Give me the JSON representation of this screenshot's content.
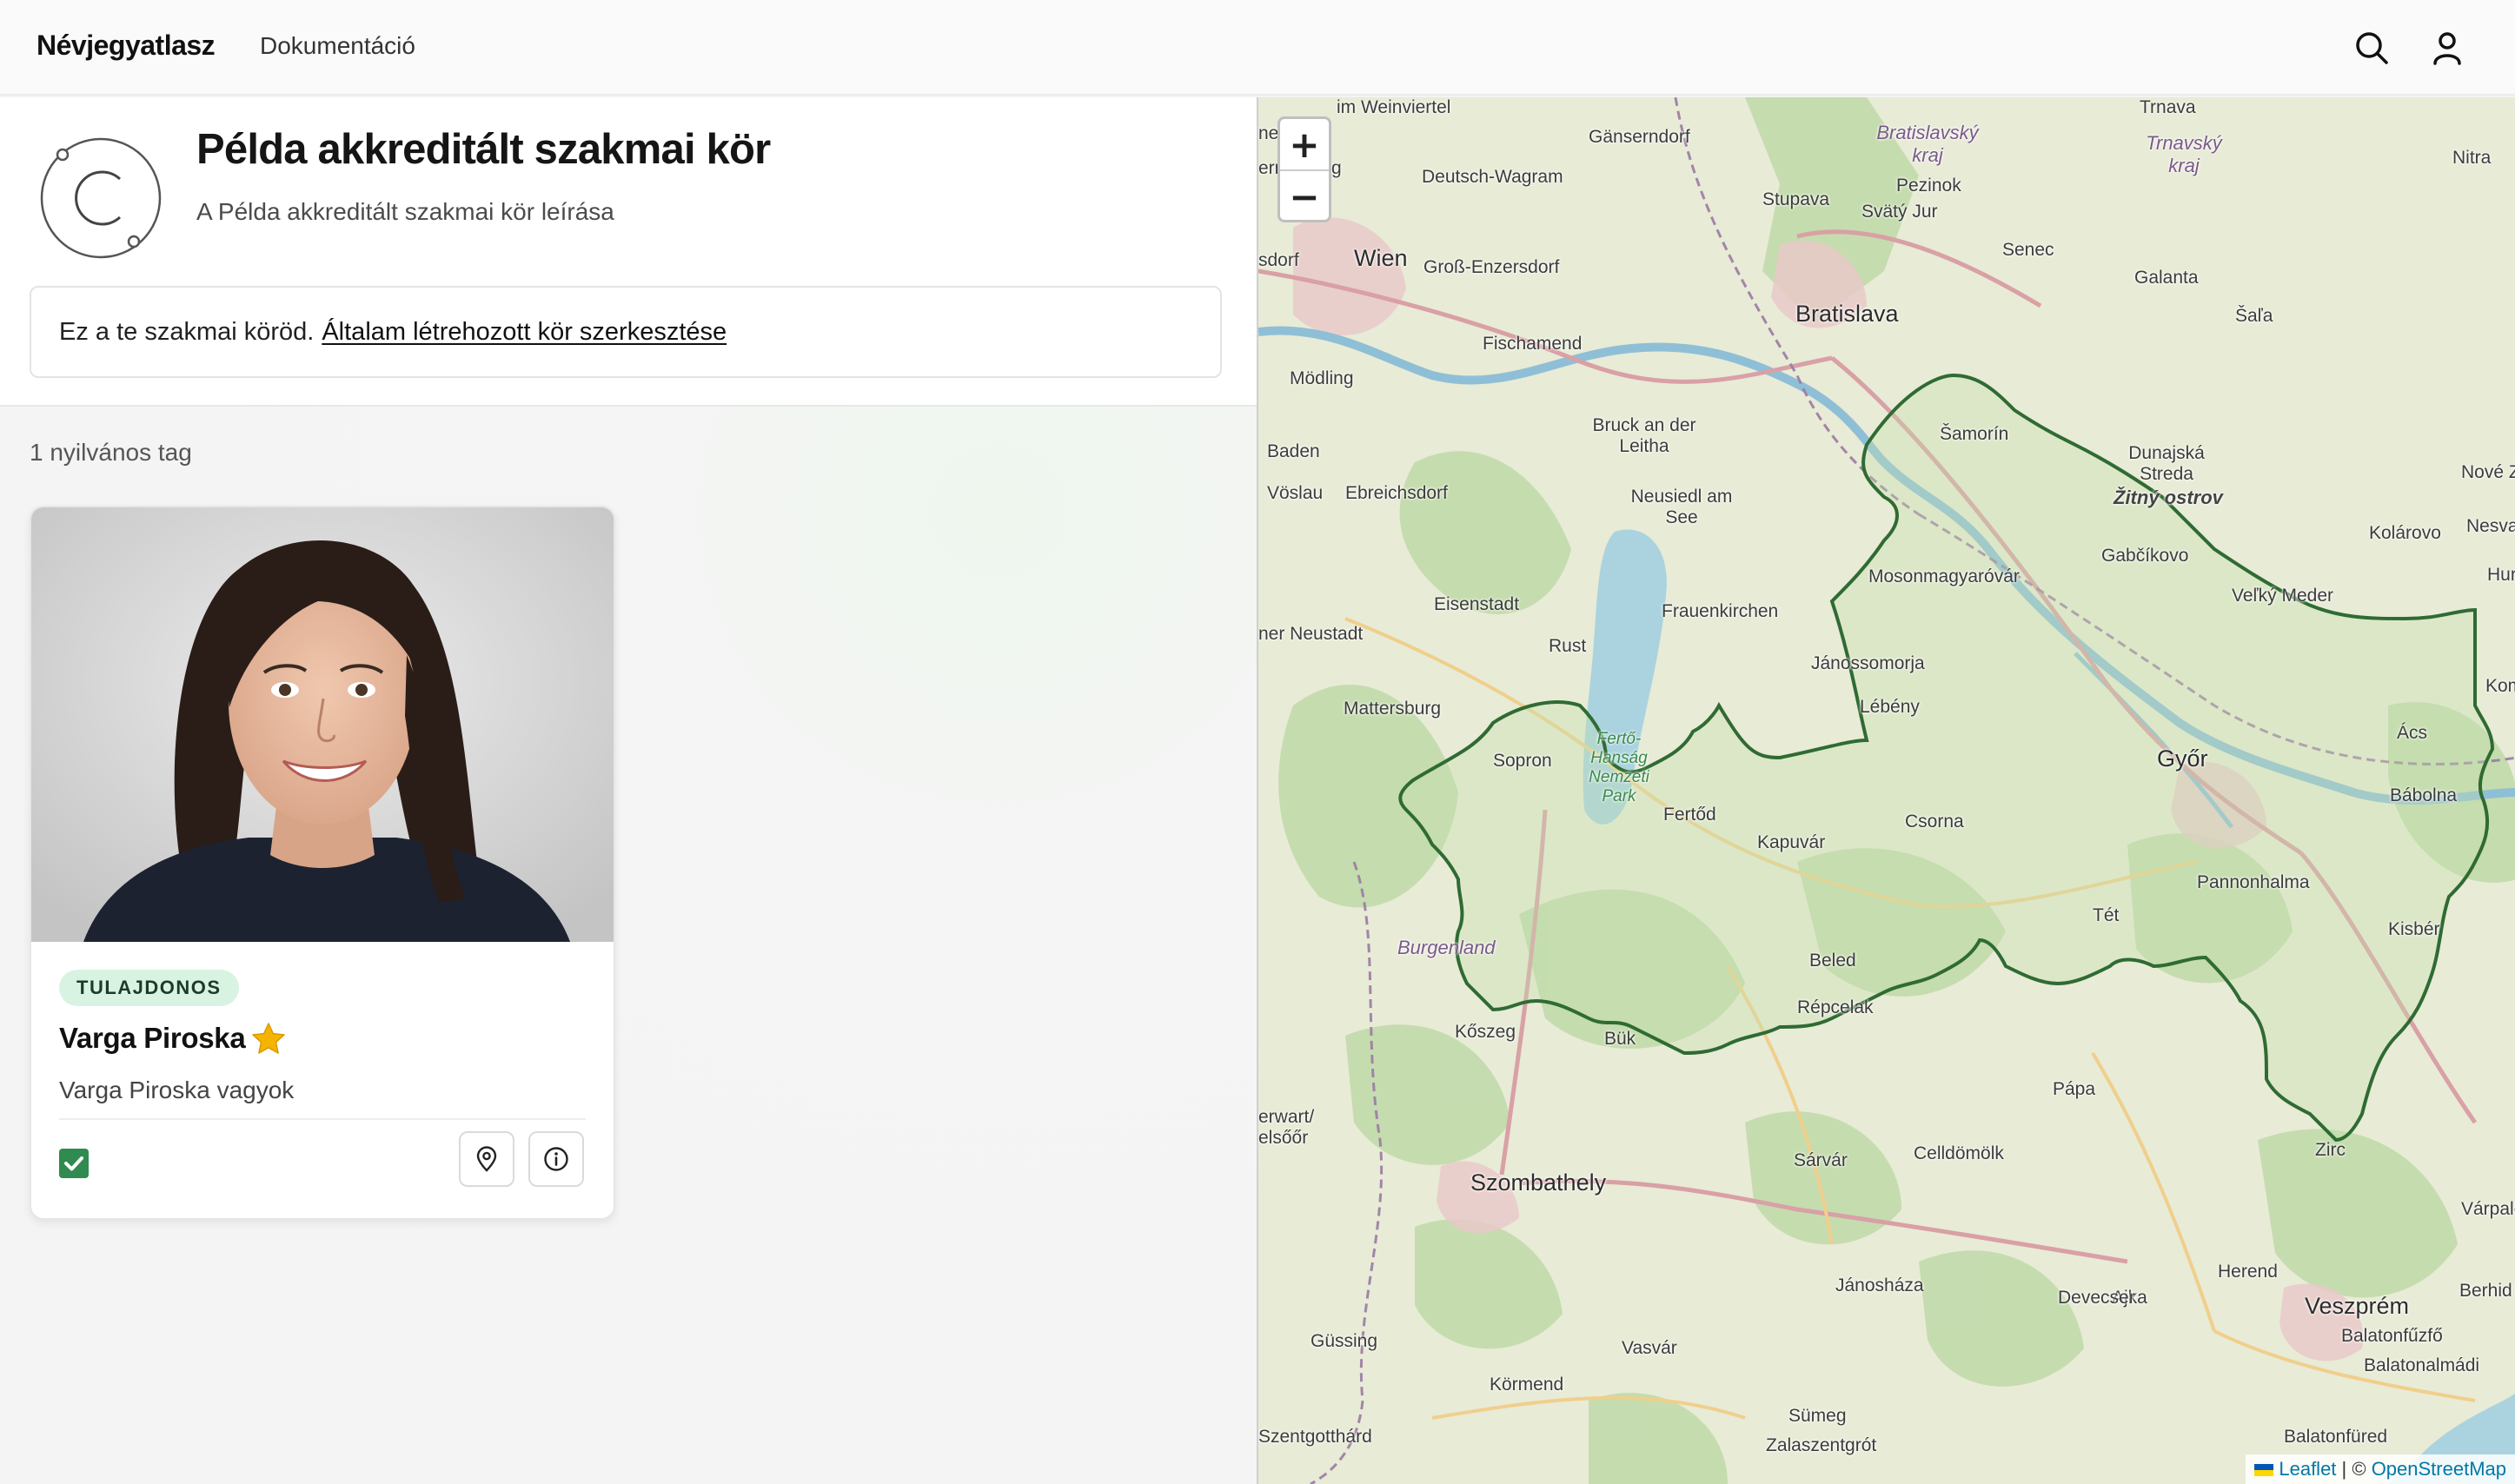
{
  "header": {
    "brand": "Névjegyatlasz",
    "nav_documentation": "Dokumentáció",
    "icons": [
      "search-icon",
      "user-icon"
    ]
  },
  "circle": {
    "title": "Példa akkreditált szakmai kör",
    "description": "A Példa akkreditált szakmai kör leírása",
    "notice_text": "Ez a te szakmai köröd.",
    "notice_link": "Általam létrehozott kör szerkesztése",
    "member_count": "1 nyilvános tag"
  },
  "member": {
    "badge": "TULAJDONOS",
    "name": "Varga Piroska",
    "bio": "Varga Piroska vagyok",
    "checked": true,
    "actions": [
      "location-pin-icon",
      "info-icon"
    ]
  },
  "map": {
    "zoom_in": "+",
    "zoom_out": "−",
    "attribution_leaflet": "Leaflet",
    "attribution_sep": " | © ",
    "attribution_osm": "OpenStreetMap",
    "labels": {
      "wien": "Wien",
      "bratislava": "Bratislava",
      "gyor": "Győr",
      "szombathely": "Szombathely",
      "veszprem": "Veszprém",
      "sopron": "Sopron",
      "mosonmagyarovar": "Mosonmagyaróvár",
      "papa": "Pápa",
      "kapuvar": "Kapuvár",
      "csorna": "Csorna",
      "zitny": "Žitný ostrov",
      "burgenland": "Burgenland",
      "trnava": "Trnava",
      "nitra": "Nitra",
      "samorin": "Šamorín",
      "eisenstadt": "Eisenstadt",
      "neusiedl": "Neusiedl am See",
      "bruck": "Bruck an der Leitha",
      "koszeg": "Kőszeg",
      "tet": "Tét",
      "pannonhalma": "Pannonhalma",
      "kisber": "Kisbér",
      "babolna": "Bábolna",
      "acs": "Ács",
      "zirc": "Zirc",
      "sarvar": "Sárvár",
      "celldomolk": "Celldömölk",
      "fertod": "Fertőd",
      "beled": "Beled",
      "repcelak": "Répcelak",
      "buk": "Bük",
      "mattersburg": "Mattersburg",
      "janoshaza": "Jánosháza",
      "sumeg": "Sümeg",
      "herend": "Herend",
      "ajka": "Ajka",
      "devecser": "Devecser",
      "kormend": "Körmend",
      "vasvar": "Vasvár",
      "gabcikovo": "Gabčíkovo",
      "velky_meder": "Veľký Meder",
      "dunajska": "Dunajská Streda",
      "senec": "Senec",
      "stupava": "Stupava",
      "lebeny": "Lébény",
      "janossomorja": "Jánossomorja",
      "frauenkirchen": "Frauenkirchen",
      "rust": "Rust",
      "fischamend": "Fischamend",
      "modling": "Mödling",
      "baden": "Baden",
      "ebreichsdorf": "Ebreichsdorf",
      "gross_enzersdorf": "Groß-Enzersdorf",
      "deutsch_wagram": "Deutsch-Wagram",
      "gansendorf": "Gänserndorf",
      "svaty_jur": "Svätý Jur",
      "pezinok": "Pezinok",
      "galanta": "Galanta",
      "sala": "Šaľa",
      "kolarovo": "Kolárovo",
      "komarno": "Komárn",
      "gussing": "Güssing",
      "szentgotthard": "Szentgotthárd",
      "zalaszentgrot": "Zalaszentgrót",
      "balatonfured": "Balatonfüred",
      "balatonfuzfo": "Balatonfűzfő",
      "balatonalmadi": "Balatonalmádi",
      "berhida": "Berhid",
      "varpalota": "Várpalo",
      "nove_zamky": "Nové Z",
      "nesvady": "Nesvad",
      "hurbanovo": "Hur",
      "bratislavsky": "Bratislavský kraj",
      "trnavsky": "Trnavský kraj",
      "ferto_hansag": "Fertő-Hanság Nemzeti Park",
      "stockerau": "im Weinviertel",
      "neuburg": "neuburg",
      "erneuburg": "erneuburg",
      "sdorf": "sdorf",
      "voslau": "Vöslau",
      "neustadt": "ner Neustadt",
      "erwart": "erwart/ elsőőr"
    }
  }
}
